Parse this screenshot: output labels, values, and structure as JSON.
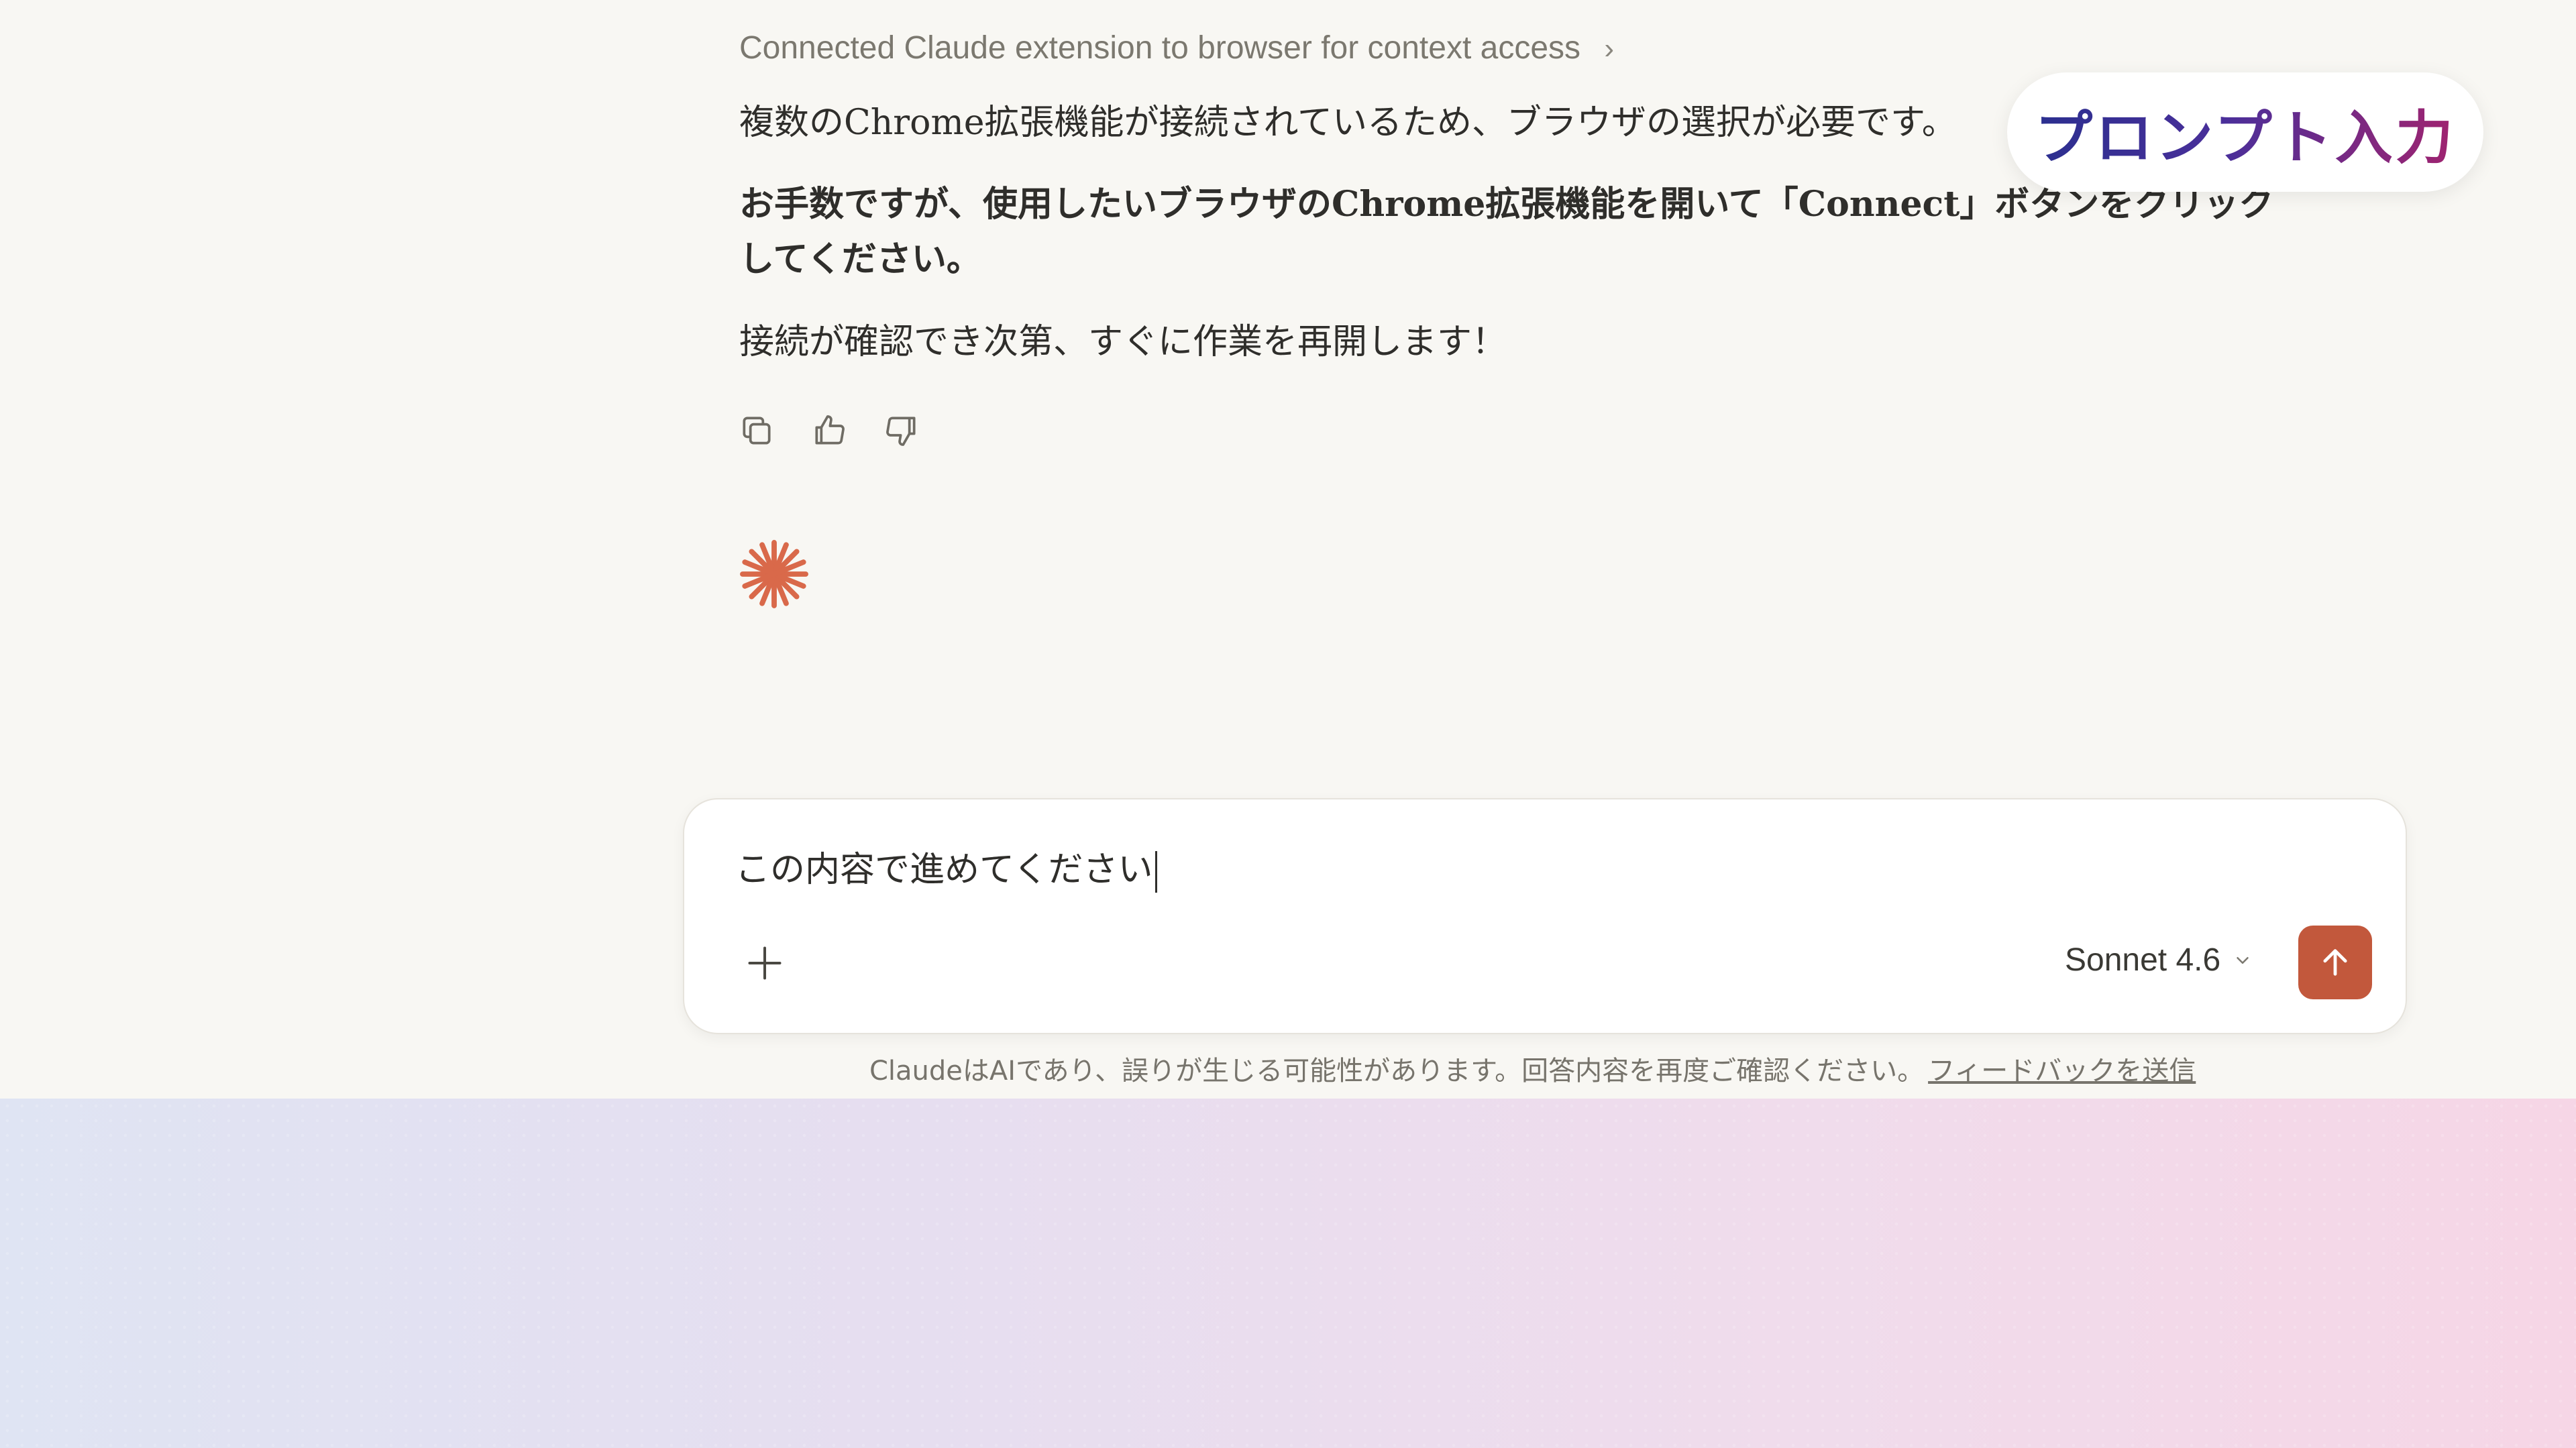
{
  "tool_status": {
    "text": "Connected Claude extension to browser for context access",
    "chevron": "›"
  },
  "assistant_message": {
    "line1": "複数のChrome拡張機能が接続されているため、ブラウザの選択が必要です。",
    "line2": "お手数ですが、使用したいブラウザのChrome拡張機能を開いて「Connect」ボタンをクリックしてください。",
    "line3": "接続が確認でき次第、すぐに作業を再開します！"
  },
  "message_actions": {
    "icons": [
      "copy-icon",
      "thumbs-up-icon",
      "thumbs-down-icon"
    ]
  },
  "overlay": {
    "label": "プロンプト入力"
  },
  "composer": {
    "value": "この内容で進めてください",
    "model": "Sonnet 4.6"
  },
  "footer": {
    "disclaimer": "ClaudeはAIであり、誤りが生じる可能性があります。回答内容を再度ご確認ください。",
    "feedback_link": "フィードバックを送信"
  },
  "colors": {
    "background": "#f8f7f3",
    "accent": "#c2583c",
    "spark": "#d9694a"
  }
}
